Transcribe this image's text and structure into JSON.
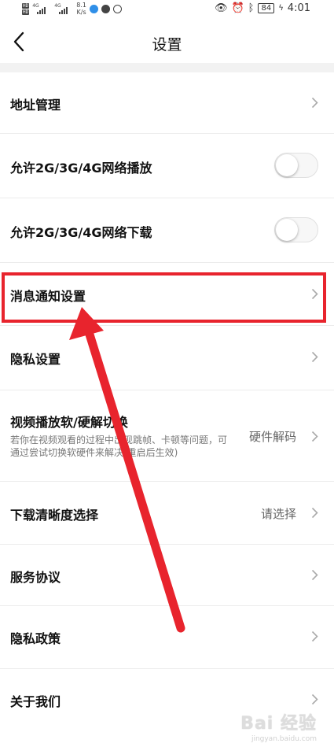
{
  "status_bar": {
    "hd_top": "HD",
    "hd_bottom": "HD",
    "net1": "4G",
    "net2": "4G",
    "speed_value": "8.1",
    "speed_unit": "K/s",
    "battery": "84",
    "time": "4:01"
  },
  "nav": {
    "title": "设置"
  },
  "settings": {
    "address": {
      "label": "地址管理"
    },
    "allow_play": {
      "label": "允许2G/3G/4G网络播放",
      "on": false
    },
    "allow_download": {
      "label": "允许2G/3G/4G网络下载",
      "on": false
    },
    "notification": {
      "label": "消息通知设置"
    },
    "privacy_settings": {
      "label": "隐私设置"
    },
    "decode": {
      "label": "视频播放软/硬解切换",
      "sub": "若你在视频观看的过程中出现跳帧、卡顿等问题，可通过尝试切换软硬件来解决(重启后生效)",
      "value": "硬件解码"
    },
    "download_quality": {
      "label": "下载清晰度选择",
      "value": "请选择"
    },
    "service_agreement": {
      "label": "服务协议"
    },
    "privacy_policy": {
      "label": "隐私政策"
    },
    "about": {
      "label": "关于我们"
    }
  },
  "watermark": {
    "text": "Bai 经验",
    "sub": "jingyan.baidu.com"
  },
  "colors": {
    "annotation_red": "#e8242d",
    "divider": "#ececec",
    "band": "#f2f2f2"
  }
}
